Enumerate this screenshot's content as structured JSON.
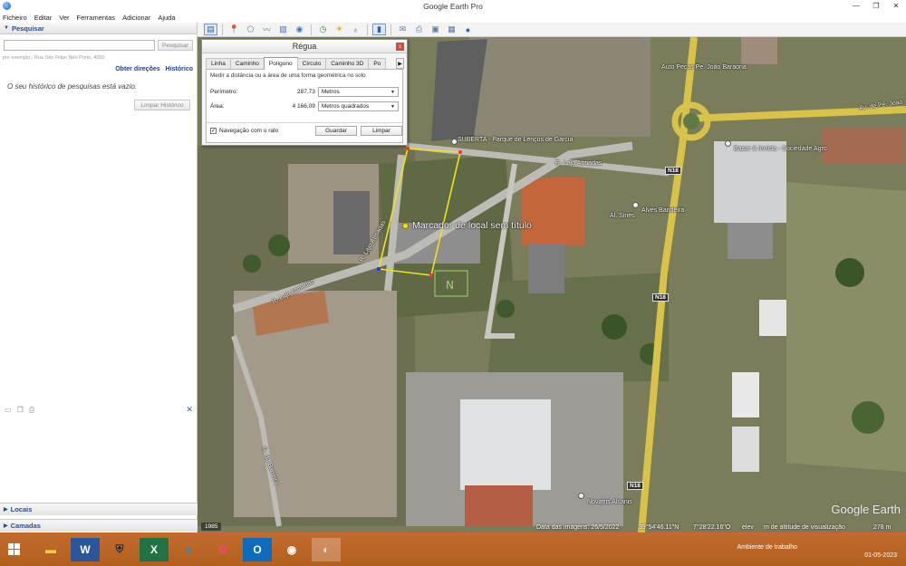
{
  "window": {
    "title": "Google Earth Pro"
  },
  "menu": [
    "Ficheiro",
    "Editar",
    "Ver",
    "Ferramentas",
    "Adicionar",
    "Ajuda"
  ],
  "search": {
    "header": "Pesquisar",
    "placeholder": "",
    "button": "Pesquisar",
    "hint": "por exemplo,: Rua São Filipe Néri Porto, 4050",
    "link_directions": "Obter direções",
    "link_history": "Histórico",
    "empty_message": "O seu histórico de pesquisas está vazio.",
    "clear_button": "Limpar Histórico"
  },
  "sections": {
    "places": "Locais",
    "layers": "Camadas"
  },
  "ruler": {
    "title": "Régua",
    "tabs": [
      "Linha",
      "Caminho",
      "Polígono",
      "Círculo",
      "Caminho 3D",
      "Po"
    ],
    "active_tab": "Polígono",
    "description": "Medir a distância ou a área de uma forma geométrica no solo",
    "perimeter_label": "Perímetro:",
    "perimeter_value": "287,73",
    "perimeter_unit": "Metros",
    "area_label": "Área:",
    "area_value": "4 166,09",
    "area_unit": "Metros quadrados",
    "mouse_nav_label": "Navegação com o rato",
    "mouse_nav_checked": true,
    "save_button": "Guardar",
    "clear_button": "Limpar"
  },
  "map": {
    "labels": {
      "auto_pecas": "Auto Peças Pe. João Baraona",
      "parque": "SUBERTA - Parque de Lenços de Garcia",
      "largo_regata": "R. Lajo Atmadas",
      "bazar": "Bazar & Invicta - Sociedade Agro",
      "alves": "Alves Bandeira",
      "al_sines": "Al. Sines",
      "marker": "Marcador de local sem título",
      "rua_lageosa": "R. Lajo Atmadas",
      "rua_vertical": "R. Lajo Atmadas",
      "rua_bottom": "R. da Barreira",
      "av_top": "Av. de Pê. Joao",
      "novartis": "Novatris Alcanis"
    },
    "road_shields": [
      "N18",
      "N18",
      "N18"
    ],
    "status": {
      "image_date": "Data das imagens: 26/5/2022",
      "lat": "39°54'46.11\"N",
      "lon": "7°28'22.16\"O",
      "elev": "elev",
      "streaming": "m de altitude de visualização",
      "alt": "278 m"
    },
    "year": "1985",
    "watermark": "Google Earth"
  },
  "taskbar": {
    "apps": [
      "file-explorer",
      "word",
      "app-shield",
      "excel",
      "edge",
      "paint",
      "outlook",
      "chrome",
      "google-earth"
    ],
    "desktop_label": "Ambiente de trabalho",
    "date": "01-05-2023"
  },
  "colors": {
    "accent": "#2a4e8a",
    "polygon": "#f2e11a",
    "taskbar": "#b9662a"
  }
}
